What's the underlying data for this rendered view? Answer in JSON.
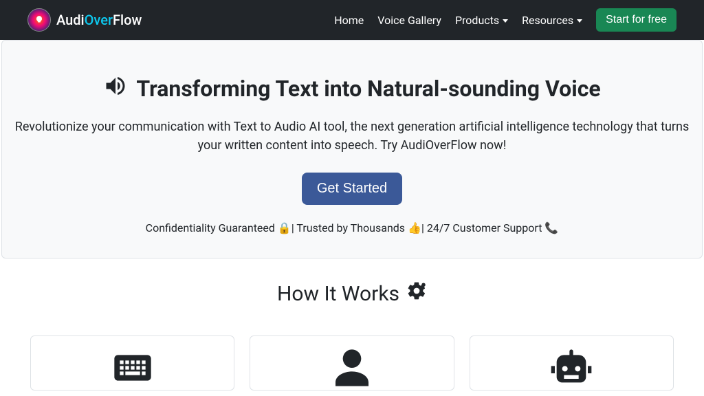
{
  "brand": {
    "part1": "Audi",
    "part2": "Over",
    "part3": "Flow"
  },
  "nav": {
    "home": "Home",
    "gallery": "Voice Gallery",
    "products": "Products",
    "resources": "Resources",
    "start_free": "Start for free"
  },
  "hero": {
    "title": "Transforming Text into Natural-sounding Voice",
    "subtitle": "Revolutionize your communication with Text to Audio AI tool, the next generation artificial intelligence technology that turns your written content into speech. Try AudiOverFlow now!",
    "cta": "Get Started",
    "trust": "Confidentiality Guaranteed 🔒| Trusted by Thousands 👍| 24/7 Customer Support 📞"
  },
  "how": {
    "title": "How It Works"
  }
}
